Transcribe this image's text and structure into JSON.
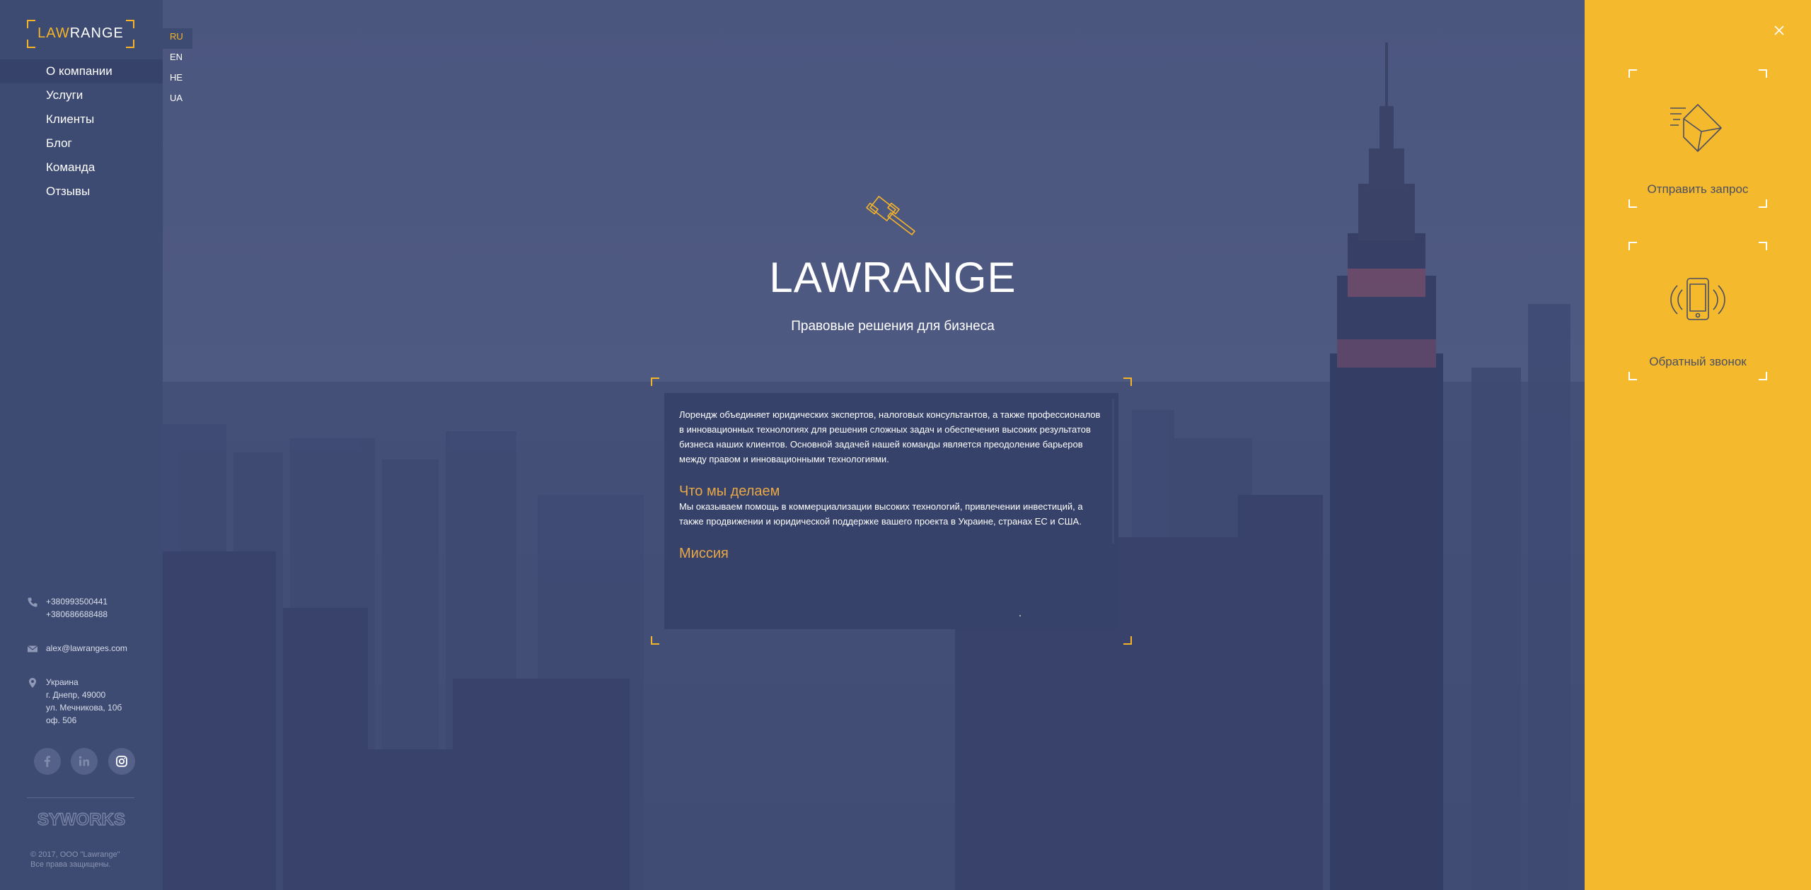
{
  "brand": {
    "logo_accent": "LAW",
    "logo_rest": "RANGE",
    "accent_color": "#f5b428",
    "panel_color": "#f5b92d"
  },
  "nav": {
    "items": [
      {
        "label": "О компании"
      },
      {
        "label": "Услуги"
      },
      {
        "label": "Клиенты"
      },
      {
        "label": "Блог"
      },
      {
        "label": "Команда"
      },
      {
        "label": "Отзывы"
      }
    ],
    "active": "О компании"
  },
  "languages": {
    "items": [
      "RU",
      "EN",
      "HE",
      "UA"
    ],
    "active": "RU"
  },
  "hero": {
    "title": "LAWRANGE",
    "subtitle": "Правовые решения для бизнеса",
    "icon": "gavel-icon"
  },
  "about": {
    "intro": "Лорендж объединяет юридических экспертов, налоговых консультантов, а также профессионалов в инновационных технологиях для решения сложных задач и обеспечения высоких результатов бизнеса наших клиентов. Основной задачей нашей команды является преодоление барьеров между правом и инновационными технологиями.",
    "what_title": "Что мы делаем",
    "what_text": "Мы оказываем помощь в коммерциализации высоких технологий, привлечении инвестиций, а также продвижении и юридической поддержке вашего проекта в Украине, странах ЕС и США.",
    "mission_title": "Миссия"
  },
  "contacts": {
    "phones": [
      "+380993500441",
      "+380686688488"
    ],
    "email": "alex@lawranges.com",
    "address": [
      "Украина",
      "г. Днепр, 49000",
      "ул. Мечникова, 10б",
      "оф. 506"
    ]
  },
  "social": [
    "facebook-icon",
    "linkedin-icon",
    "instagram-icon"
  ],
  "footer": {
    "developer": "SYWORKS",
    "copyright_1": "© 2017, ООО \"Lawrange\"",
    "copyright_2": "Все права защищены."
  },
  "actions": {
    "request_label": "Отправить запрос",
    "call_label": "Обратный звонок"
  }
}
